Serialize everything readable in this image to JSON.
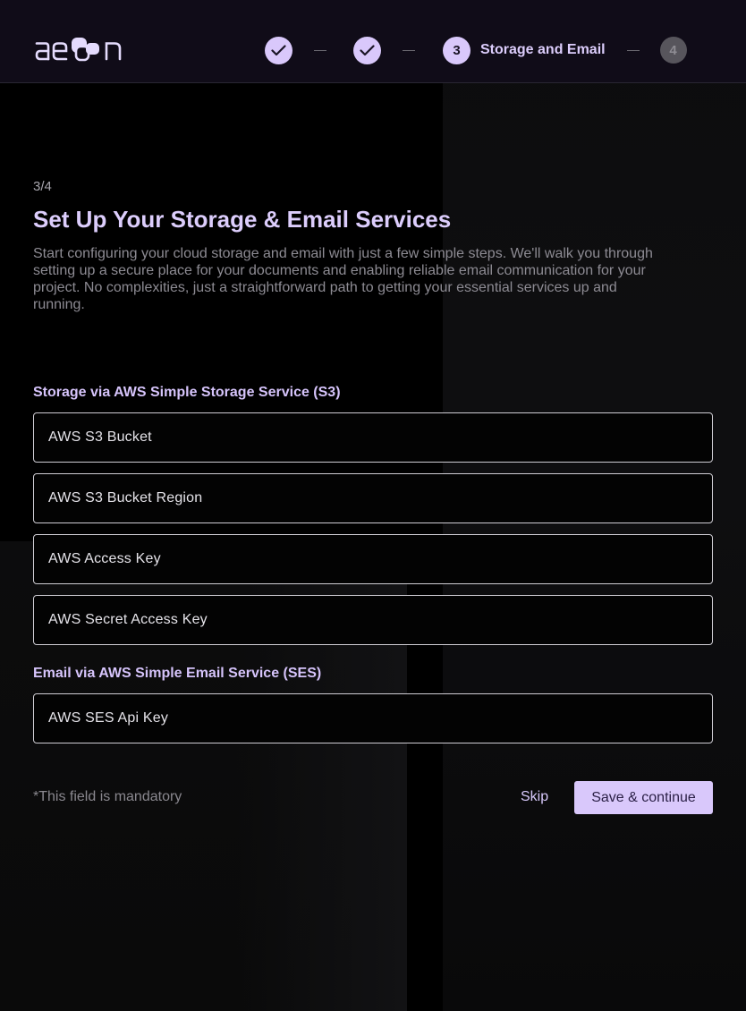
{
  "header": {
    "logo_text": "aeon",
    "steps": [
      {
        "number": "1",
        "state": "done",
        "icon": "check-icon"
      },
      {
        "number": "2",
        "state": "done",
        "icon": "check-icon"
      },
      {
        "number": "3",
        "state": "current",
        "label": "Storage and Email"
      },
      {
        "number": "4",
        "state": "future"
      }
    ]
  },
  "main": {
    "step_count": "3/4",
    "title": "Set Up Your Storage & Email Services",
    "description": "Start configuring your cloud storage and email with just a few simple steps. We'll walk you through setting up a secure place for your documents and enabling reliable email communication for your project. No complexities, just a straightforward path to getting your essential services up and running.",
    "storage_section": {
      "label": "Storage via AWS Simple Storage Service (S3)",
      "fields": [
        {
          "placeholder": "AWS S3 Bucket",
          "value": ""
        },
        {
          "placeholder": "AWS S3 Bucket Region",
          "value": ""
        },
        {
          "placeholder": "AWS Access Key",
          "value": ""
        },
        {
          "placeholder": "AWS Secret Access Key",
          "value": ""
        }
      ]
    },
    "email_section": {
      "label": "Email via AWS Simple Email Service (SES)",
      "fields": [
        {
          "placeholder": "AWS SES Api Key",
          "value": ""
        }
      ]
    },
    "mandatory_note": "*This field is mandatory",
    "skip_label": "Skip",
    "save_label": "Save & continue"
  },
  "colors": {
    "accent": "#d9c8fb",
    "header_bg": "#100c18",
    "page_bg": "#000000"
  }
}
